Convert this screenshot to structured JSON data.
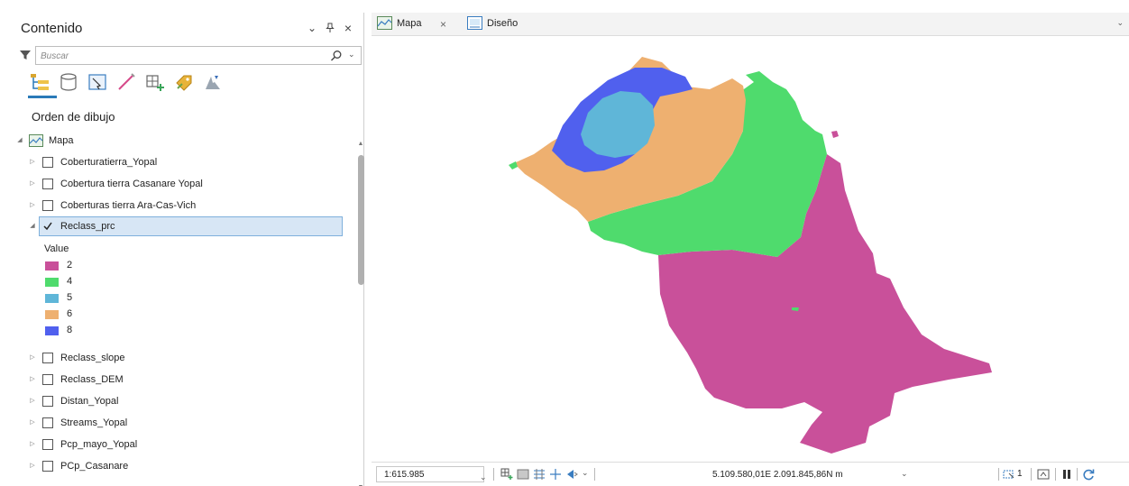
{
  "contents": {
    "title": "Contenido",
    "controls": {
      "menu": "⌄",
      "pin": "⫯",
      "close": "×"
    },
    "search": {
      "placeholder": "Buscar"
    },
    "toolbar_icons": [
      "list-by-drawing-order-icon",
      "list-by-source-icon",
      "list-by-selection-icon",
      "list-by-editing-icon",
      "list-by-snapping-icon",
      "list-by-labeling-icon",
      "list-by-charts-icon"
    ],
    "section_heading": "Orden de dibujo",
    "map_node": "Mapa",
    "layers": [
      {
        "label": "Coberturatierra_Yopal",
        "checked": false
      },
      {
        "label": "Cobertura tierra Casanare Yopal",
        "checked": false
      },
      {
        "label": "Coberturas tierra Ara-Cas-Vich",
        "checked": false
      },
      {
        "label": "Reclass_prc",
        "checked": true,
        "selected": true
      },
      {
        "label": "Reclass_slope",
        "checked": false
      },
      {
        "label": "Reclass_DEM",
        "checked": false
      },
      {
        "label": "Distan_Yopal",
        "checked": false
      },
      {
        "label": "Streams_Yopal",
        "checked": false
      },
      {
        "label": "Pcp_mayo_Yopal",
        "checked": false
      },
      {
        "label": "PCp_Casanare",
        "checked": false
      }
    ],
    "legend": {
      "title": "Value",
      "items": [
        {
          "label": "2",
          "color": "#c9509a"
        },
        {
          "label": "4",
          "color": "#4fdb6d"
        },
        {
          "label": "5",
          "color": "#5fb6d8"
        },
        {
          "label": "6",
          "color": "#eeb070"
        },
        {
          "label": "8",
          "color": "#5060ee"
        }
      ]
    }
  },
  "tabs": [
    {
      "label": "Mapa",
      "active": true,
      "closable": true
    },
    {
      "label": "Diseño",
      "active": false,
      "closable": false
    }
  ],
  "status": {
    "scale": "1:615.985",
    "coordinates": "5.109.580,01E 2.091.845,86N m",
    "selected_count": "1"
  },
  "colors": {
    "accent": "#2a7ab8",
    "selection_bg": "#d7e6f5",
    "class_2": "#c9509a",
    "class_4": "#4fdb6d",
    "class_5": "#5fb6d8",
    "class_6": "#eeb070",
    "class_8": "#5060ee"
  }
}
